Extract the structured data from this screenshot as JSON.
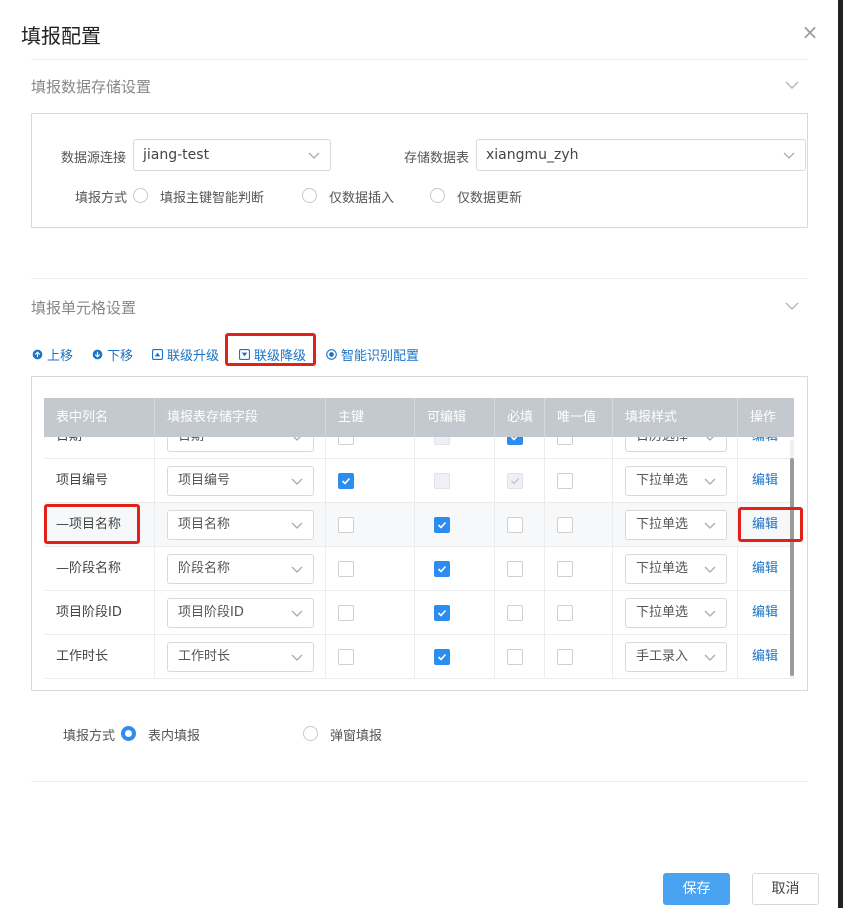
{
  "dialog": {
    "title": "填报配置",
    "close_icon": "×"
  },
  "storage": {
    "section_title": "填报数据存储设置",
    "datasource_label": "数据源连接",
    "datasource_value": "jiang-test",
    "table_label": "存储数据表",
    "table_value": "xiangmu_zyh",
    "mode_label": "填报方式",
    "modes": [
      "填报主键智能判断",
      "仅数据插入",
      "仅数据更新"
    ]
  },
  "cells": {
    "section_title": "填报单元格设置",
    "toolbar": {
      "up": "上移",
      "down": "下移",
      "cascade_up": "联级升级",
      "cascade_down": "联级降级",
      "smart": "智能识别配置"
    },
    "headers": [
      "表中列名",
      "填报表存储字段",
      "主键",
      "可编辑",
      "必填",
      "唯一值",
      "填报样式",
      "操作"
    ],
    "rows": [
      {
        "name": "日期",
        "field": "日期",
        "style": "日历选择",
        "edit": "编辑"
      },
      {
        "name": "项目编号",
        "field": "项目编号",
        "style": "下拉单选",
        "edit": "编辑"
      },
      {
        "name": "—项目名称",
        "field": "项目名称",
        "style": "下拉单选",
        "edit": "编辑"
      },
      {
        "name": "—阶段名称",
        "field": "阶段名称",
        "style": "下拉单选",
        "edit": "编辑"
      },
      {
        "name": "项目阶段ID",
        "field": "项目阶段ID",
        "style": "下拉单选",
        "edit": "编辑"
      },
      {
        "name": "工作时长",
        "field": "工作时长",
        "style": "手工录入",
        "edit": "编辑"
      }
    ],
    "fill_mode_label": "填报方式",
    "fill_modes": [
      "表内填报",
      "弹窗填报"
    ]
  },
  "footer": {
    "save": "保存",
    "cancel": "取消"
  },
  "colors": {
    "accent": "#2d8cf0",
    "link": "#1a73c7",
    "highlight": "#e0221b",
    "primary_button": "#4aa3f0"
  }
}
